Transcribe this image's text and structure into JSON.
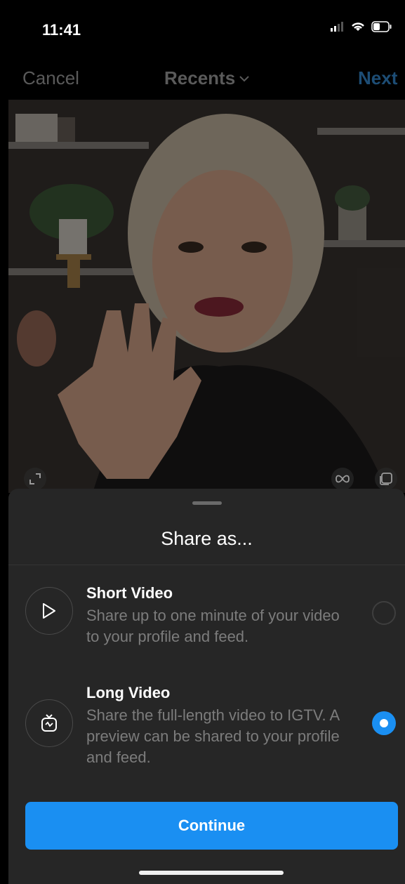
{
  "status": {
    "time": "11:41"
  },
  "nav": {
    "cancel": "Cancel",
    "title": "Recents",
    "next": "Next"
  },
  "sheet": {
    "title": "Share as...",
    "options": [
      {
        "title": "Short Video",
        "description": "Share up to one minute of your video to your profile and feed.",
        "icon": "play-icon",
        "selected": false
      },
      {
        "title": "Long Video",
        "description": "Share the full-length video to IGTV. A preview can be shared to your profile and feed.",
        "icon": "igtv-icon",
        "selected": true
      }
    ],
    "continue_label": "Continue"
  },
  "colors": {
    "accent": "#1a8ff2",
    "sheet_bg": "#262626",
    "muted_text": "#7c7c7c"
  }
}
